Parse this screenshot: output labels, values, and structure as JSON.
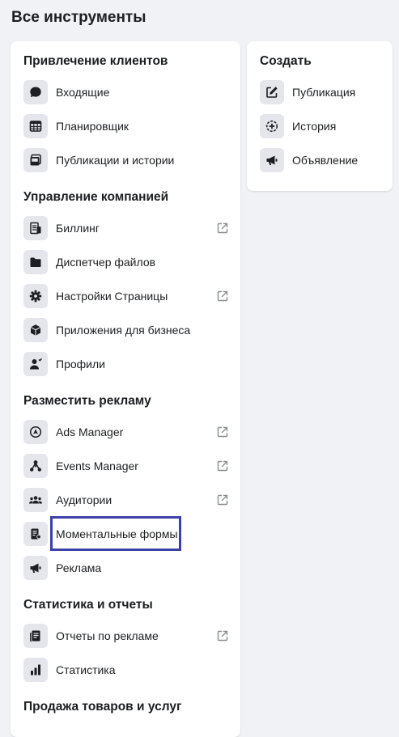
{
  "page_title": "Все инструменты",
  "left_card": {
    "sections": [
      {
        "title": "Привлечение клиентов",
        "items": [
          {
            "label": "Входящие",
            "icon": "chat-bubble-icon",
            "external": false
          },
          {
            "label": "Планировщик",
            "icon": "calendar-icon",
            "external": false
          },
          {
            "label": "Публикации и истории",
            "icon": "posts-stories-icon",
            "external": false
          }
        ]
      },
      {
        "title": "Управление компанией",
        "items": [
          {
            "label": "Биллинг",
            "icon": "billing-icon",
            "external": true
          },
          {
            "label": "Диспетчер файлов",
            "icon": "folder-icon",
            "external": false
          },
          {
            "label": "Настройки Страницы",
            "icon": "gear-icon",
            "external": true
          },
          {
            "label": "Приложения для бизнеса",
            "icon": "cube-icon",
            "external": false
          },
          {
            "label": "Профили",
            "icon": "profile-icon",
            "external": false
          }
        ]
      },
      {
        "title": "Разместить рекламу",
        "items": [
          {
            "label": "Ads Manager",
            "icon": "ads-manager-icon",
            "external": true
          },
          {
            "label": "Events Manager",
            "icon": "events-manager-icon",
            "external": true
          },
          {
            "label": "Аудитории",
            "icon": "audience-icon",
            "external": true
          },
          {
            "label": "Моментальные формы",
            "icon": "instant-form-icon",
            "external": false,
            "highlighted": true
          },
          {
            "label": "Реклама",
            "icon": "megaphone-icon",
            "external": false
          }
        ]
      },
      {
        "title": "Статистика и отчеты",
        "items": [
          {
            "label": "Отчеты по рекламе",
            "icon": "ad-reports-icon",
            "external": true
          },
          {
            "label": "Статистика",
            "icon": "bar-chart-icon",
            "external": false
          }
        ]
      },
      {
        "title": "Продажа товаров и услуг",
        "items": []
      }
    ]
  },
  "right_card": {
    "title": "Создать",
    "items": [
      {
        "label": "Публикация",
        "icon": "edit-icon"
      },
      {
        "label": "История",
        "icon": "story-add-icon"
      },
      {
        "label": "Объявление",
        "icon": "megaphone-icon"
      }
    ]
  },
  "colors": {
    "background": "#f0f2f5",
    "card": "#ffffff",
    "icon_bg": "#e4e6eb",
    "highlight_border": "#3b40a8"
  }
}
